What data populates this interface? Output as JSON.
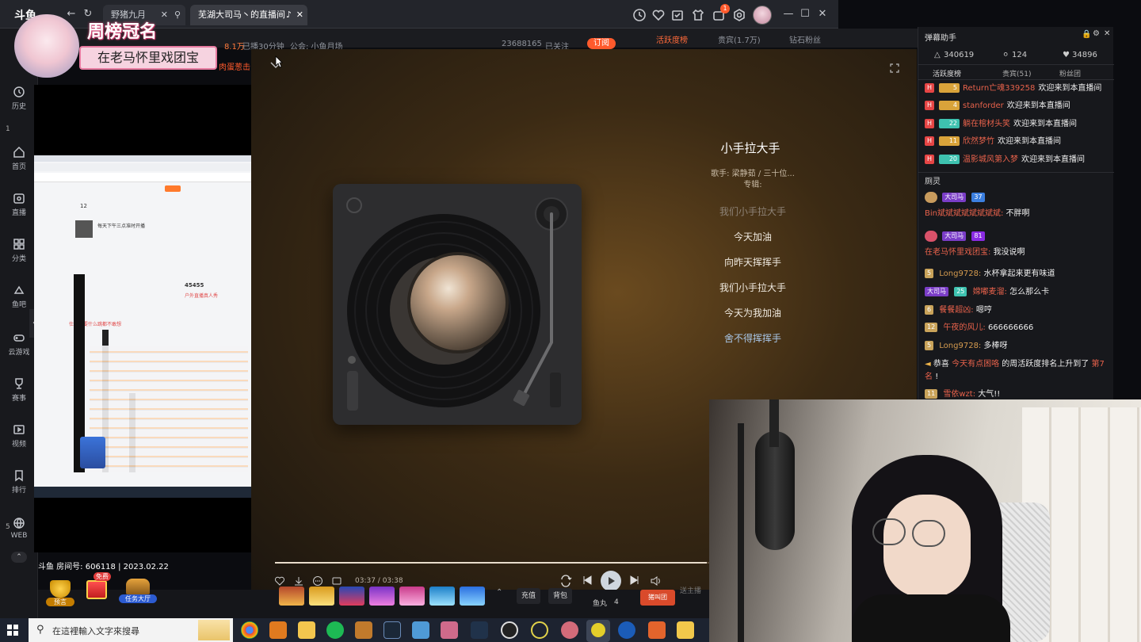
{
  "browser": {
    "logo_text": "斗鱼",
    "tabs": [
      {
        "label": "野猪九月"
      },
      {
        "label": "芜湖大司马丶的直播间"
      }
    ],
    "notification_count": "1"
  },
  "banner": {
    "title": "周榜冠名",
    "subtitle": "在老马怀里戏团宝",
    "tag_text": "肉蛋葱击"
  },
  "stream_meta": {
    "fans": "8.1万",
    "status": "已播30分钟",
    "notice": "公会: 小鱼月场",
    "viewer_number": "23688165",
    "follow_state": "已关注",
    "subscribe": "订阅",
    "top_tabs": [
      "活跃度榜",
      "贵宾(1.7万)",
      "钻石粉丝"
    ]
  },
  "leftnav": {
    "items": [
      {
        "label": "历史",
        "icon": "clock-icon"
      },
      {
        "label": "首页",
        "icon": "home-icon"
      },
      {
        "label": "直播",
        "icon": "live-icon"
      },
      {
        "label": "分类",
        "icon": "grid-icon"
      },
      {
        "label": "鱼吧",
        "icon": "fish-icon"
      },
      {
        "label": "云游戏",
        "icon": "gamepad-icon"
      },
      {
        "label": "赛事",
        "icon": "trophy-icon"
      },
      {
        "label": "视频",
        "icon": "video-icon"
      },
      {
        "label": "排行",
        "icon": "bookmark-icon"
      },
      {
        "label": "WEB",
        "icon": "web-icon"
      }
    ],
    "side_numbers": [
      "1",
      "5"
    ]
  },
  "share": {
    "room_label": "斗鱼 房间号: 606118 | 2023.02.22",
    "inner_texts": [
      "12",
      "45455",
      "户外直播真人秀",
      "仕么预要什么跳都不敢想",
      "每天下午三点准时开播"
    ]
  },
  "player": {
    "song_title": "小手拉大手",
    "artist": "歌手: 梁静茹 / 三十位...",
    "album": "专辑:",
    "lyrics": [
      "我们小手拉大手",
      "今天加油",
      "向昨天挥挥手",
      "我们小手拉大手",
      "今天为我加油",
      "舍不得挥挥手"
    ],
    "time": "03:37 / 03:38",
    "progress": 0.995
  },
  "chat": {
    "title": "弹幕助手",
    "stats": [
      "340619",
      "124",
      "34896"
    ],
    "tabs": [
      "活跃度榜",
      "贵宾(51)",
      "粉丝团"
    ],
    "welcome": [
      {
        "level": "5",
        "user": "Return亡魂339258",
        "msg": "欢迎来到本直播间",
        "color": "#d9a33a"
      },
      {
        "level": "4",
        "user": "stanforder",
        "msg": "欢迎来到本直播间",
        "color": "#d9a33a"
      },
      {
        "level": "22",
        "user": "躺在棺材头笑",
        "msg": "欢迎来到本直播间",
        "color": "#3ec2b0"
      },
      {
        "level": "11",
        "user": "欣然梦竹",
        "msg": "欢迎来到本直播间",
        "color": "#d9a33a"
      },
      {
        "level": "20",
        "user": "温影城风第入梦",
        "msg": "欢迎来到本直播间",
        "color": "#3ec2b0"
      }
    ],
    "section_label": "厕灵",
    "messages": [
      {
        "badge": "大司马",
        "level": "37",
        "user": "Bin斌斌斌斌斌斌斌斌:",
        "msg": "不胖啊"
      },
      {
        "badge": "大司马",
        "level": "81",
        "user": "在老马怀里戏团宝:",
        "msg": "我没说啊"
      },
      {
        "level": "5",
        "user": "Long9728:",
        "msg": "水杯拿起来更有味道"
      },
      {
        "badge": "大司马",
        "level": "25",
        "user": "嫦嘟麦溜:",
        "msg": "怎么那么卡"
      },
      {
        "level": "6",
        "user": "餐餐超凶:",
        "msg": "嗯哼"
      },
      {
        "level": "12",
        "user": "午夜的风儿:",
        "msg": "666666666"
      },
      {
        "level": "5",
        "user": "Long9728:",
        "msg": "多棒呀"
      }
    ],
    "system": {
      "prefix": "恭喜",
      "user": "今天有点困咯",
      "text": "的周活跃度排名上升到了",
      "rank": "第7名",
      "end": "!"
    },
    "last": {
      "level": "11",
      "user": "雪依wzt:",
      "msg": "大气!!"
    }
  },
  "bottom": {
    "gifts": [
      {
        "label": "预言"
      },
      {
        "label": "免费"
      },
      {
        "label": "任务大厅"
      }
    ],
    "buttons": [
      "充值",
      "背包"
    ],
    "fishball": "鱼丸",
    "fishball_count": "4",
    "cart": "猪叫团",
    "extra": "送主播"
  },
  "taskbar": {
    "search_placeholder": "在這裡輸入文字來搜尋"
  }
}
